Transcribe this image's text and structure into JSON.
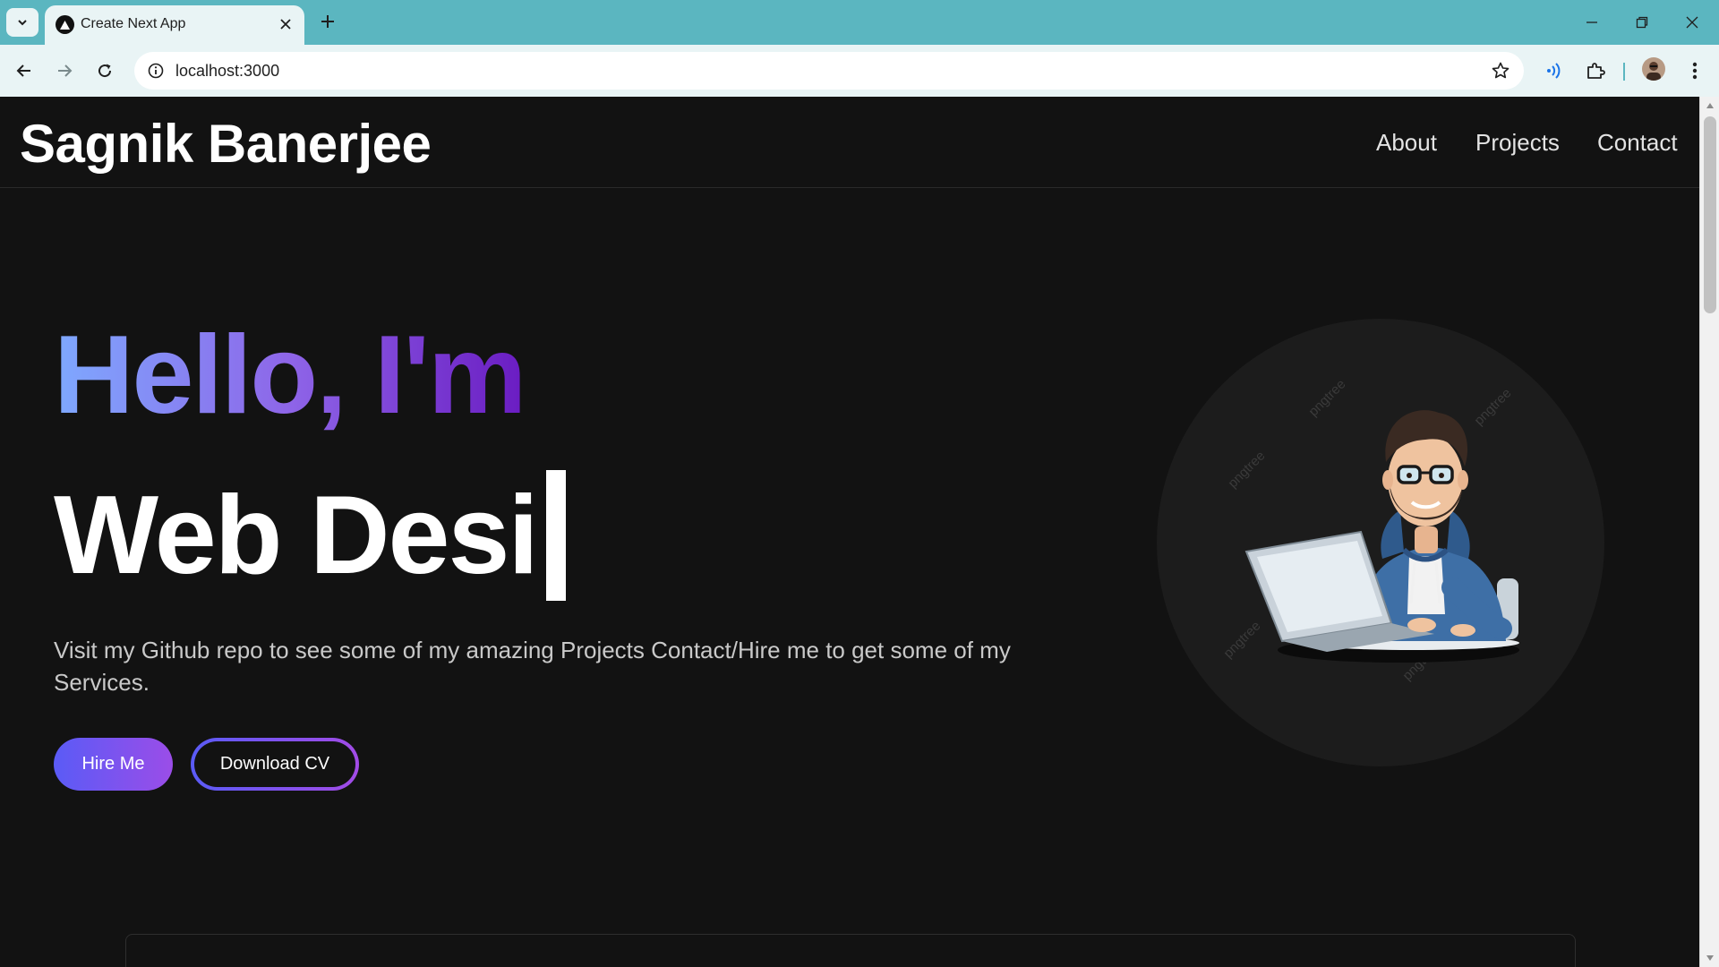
{
  "browser": {
    "tab_title": "Create Next App",
    "url": "localhost:3000"
  },
  "site": {
    "brand": "Sagnik Banerjee",
    "nav": [
      "About",
      "Projects",
      "Contact"
    ]
  },
  "hero": {
    "greeting": "Hello, I'm",
    "typed_text": "Web Desi",
    "description": "Visit my Github repo to see some of my amazing Projects Contact/Hire me to get some of my Services.",
    "hire_button": "Hire Me",
    "cv_button": "Download CV"
  },
  "avatar": {
    "watermark": "pngtree"
  },
  "colors": {
    "page_background": "#121212",
    "accent_start": "#5a5bf6",
    "accent_end": "#9b4de8",
    "greeting_gradient": [
      "#7ea9ff",
      "#8e65e8",
      "#6a1cc2"
    ],
    "tab_strip": "#5bb6c0"
  }
}
